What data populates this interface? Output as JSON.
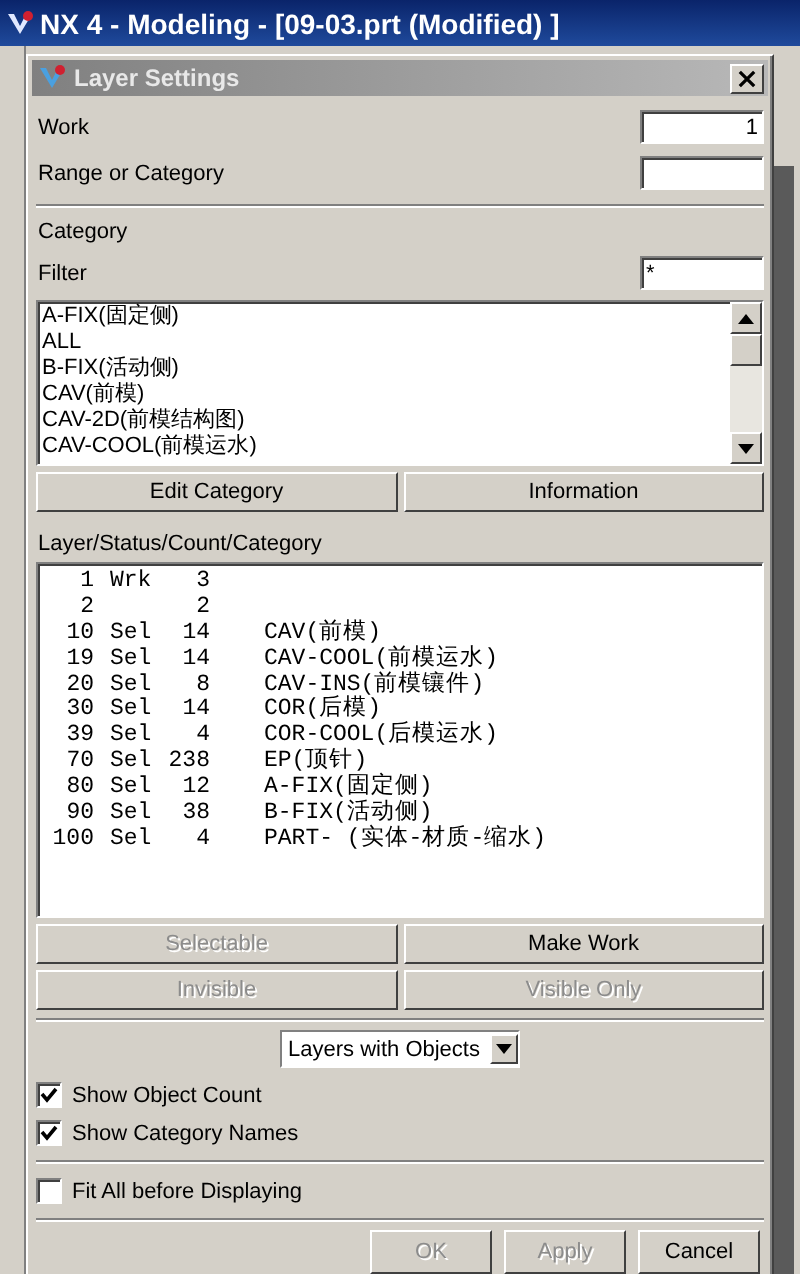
{
  "app": {
    "title": "NX 4 - Modeling - [09-03.prt (Modified) ]"
  },
  "dialog": {
    "title": "Layer Settings",
    "work": {
      "label": "Work",
      "value": "1"
    },
    "range": {
      "label": "Range or Category"
    },
    "category_heading": "Category",
    "filter": {
      "label": "Filter",
      "value": "*"
    },
    "categories": [
      "A-FIX(固定侧)",
      "ALL",
      "B-FIX(活动侧)",
      "CAV(前模)",
      "CAV-2D(前模结构图)",
      "CAV-COOL(前模运水)"
    ],
    "category_buttons": [
      {
        "label": "Edit Category",
        "disabled": false
      },
      {
        "label": "Information",
        "disabled": false
      }
    ],
    "layers_heading": "Layer/Status/Count/Category",
    "layers": [
      {
        "layer": "1",
        "status": "Wrk",
        "count": "3"
      },
      {
        "layer": "2",
        "count": "2"
      },
      {
        "layer": "10",
        "status": "Sel",
        "count": "14",
        "category": "CAV(前模)"
      },
      {
        "layer": "19",
        "status": "Sel",
        "count": "14",
        "category": "CAV-COOL(前模运水)"
      },
      {
        "layer": "20",
        "status": "Sel",
        "count": "8",
        "category": "CAV-INS(前模镶件)"
      },
      {
        "layer": "30",
        "status": "Sel",
        "count": "14",
        "category": "COR(后模)"
      },
      {
        "layer": "39",
        "status": "Sel",
        "count": "4",
        "category": "COR-COOL(后模运水)"
      },
      {
        "layer": "70",
        "status": "Sel",
        "count": "238",
        "category": "EP(顶针)"
      },
      {
        "layer": "80",
        "status": "Sel",
        "count": "12",
        "category": "A-FIX(固定侧)"
      },
      {
        "layer": "90",
        "status": "Sel",
        "count": "38",
        "category": "B-FIX(活动侧)"
      },
      {
        "layer": "100",
        "status": "Sel",
        "count": "4",
        "category": "PART- (实体-材质-缩水)"
      }
    ],
    "layer_buttons": [
      {
        "label": "Selectable",
        "disabled": true
      },
      {
        "label": "Make Work",
        "disabled": false
      },
      {
        "label": "Invisible",
        "disabled": true
      },
      {
        "label": "Visible Only",
        "disabled": true
      }
    ],
    "display_dropdown": "Layers with Objects",
    "display_options": [
      {
        "label": "Show Object Count",
        "checked": true
      },
      {
        "label": "Show Category Names",
        "checked": true
      }
    ],
    "fit_option": {
      "label": "Fit All before Displaying",
      "checked": false
    },
    "footer_buttons": [
      {
        "label": "OK",
        "disabled": true
      },
      {
        "label": "Apply",
        "disabled": true
      },
      {
        "label": "Cancel",
        "disabled": false
      }
    ]
  }
}
